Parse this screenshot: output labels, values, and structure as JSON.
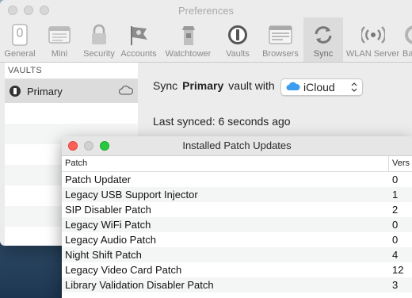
{
  "prefs": {
    "title": "Preferences",
    "toolbar": [
      {
        "label": "General",
        "icon": "general-icon"
      },
      {
        "label": "Mini",
        "icon": "mini-icon"
      },
      {
        "label": "Security",
        "icon": "lock-icon"
      },
      {
        "label": "Accounts",
        "icon": "flag-icon"
      },
      {
        "label": "Watchtower",
        "icon": "watchtower-icon"
      },
      {
        "label": "Vaults",
        "icon": "vault-icon"
      },
      {
        "label": "Browsers",
        "icon": "browser-icon"
      },
      {
        "label": "Sync",
        "icon": "sync-icon",
        "active": true
      },
      {
        "label": "WLAN Server",
        "icon": "wlan-icon"
      },
      {
        "label": "Back",
        "icon": "backup-icon"
      }
    ]
  },
  "sidebar": {
    "header": "VAULTS",
    "vault_name": "Primary"
  },
  "sync": {
    "prefix": "Sync",
    "vault": "Primary",
    "suffix": "vault with",
    "service": "iCloud",
    "last_synced": "Last synced: 6 seconds ago"
  },
  "patch_window": {
    "title": "Installed Patch Updates",
    "col_patch": "Patch",
    "col_version": "Vers",
    "rows": [
      {
        "name": "Patch Updater",
        "version": "0"
      },
      {
        "name": "Legacy USB Support Injector",
        "version": "1"
      },
      {
        "name": "SIP Disabler Patch",
        "version": "2"
      },
      {
        "name": "Legacy WiFi Patch",
        "version": "0"
      },
      {
        "name": "Legacy Audio Patch",
        "version": "0"
      },
      {
        "name": "Night Shift Patch",
        "version": "4"
      },
      {
        "name": "Legacy Video Card Patch",
        "version": "12"
      },
      {
        "name": "Library Validation Disabler Patch",
        "version": "3"
      }
    ]
  },
  "colors": {
    "close": "#fe5f57",
    "minimize": "#d0d0d0",
    "zoom": "#28c840",
    "icloud": "#3c9cf0"
  }
}
